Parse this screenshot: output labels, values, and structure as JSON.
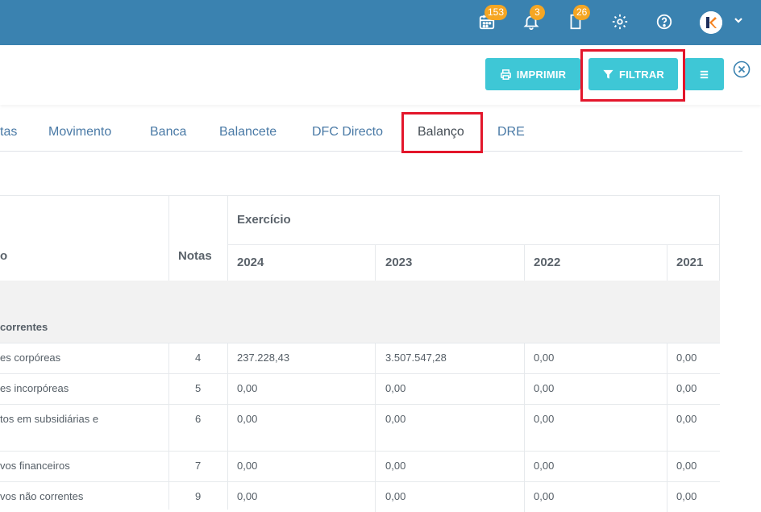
{
  "topbar": {
    "badges": {
      "calendar": "153",
      "bell": "3",
      "documents": "26"
    },
    "icons": [
      "calendar-icon",
      "bell-icon",
      "document-icon",
      "gear-icon",
      "help-icon",
      "avatar",
      "chevron-down-icon"
    ],
    "color": "#3a82b0"
  },
  "toolbar": {
    "print_label": "IMPRIMIR",
    "filter_label": "FILTRAR",
    "accent": "#3ec7d6",
    "highlight": "#e3162b"
  },
  "tabs": [
    {
      "label": "tas"
    },
    {
      "label": "Movimento"
    },
    {
      "label": "Banca"
    },
    {
      "label": "Balancete"
    },
    {
      "label": "DFC Directo"
    },
    {
      "label": "Balanço",
      "active": true
    },
    {
      "label": "DRE"
    }
  ],
  "table": {
    "col_desc": "o",
    "col_notes": "Notas",
    "group_header": "Exercício",
    "years": [
      "2024",
      "2023",
      "2022",
      "2021"
    ],
    "section": "correntes",
    "rows": [
      {
        "desc": "es corpóreas",
        "nota": "4",
        "values": [
          "237.228,43",
          "3.507.547,28",
          "0,00",
          "0,00"
        ]
      },
      {
        "desc": "es incorpóreas",
        "nota": "5",
        "values": [
          "0,00",
          "0,00",
          "0,00",
          "0,00"
        ]
      },
      {
        "desc": "tos em subsidiárias e",
        "nota": "6",
        "values": [
          "0,00",
          "0,00",
          "0,00",
          "0,00"
        ]
      },
      {
        "desc": "vos financeiros",
        "nota": "7",
        "values": [
          "0,00",
          "0,00",
          "0,00",
          "0,00"
        ]
      },
      {
        "desc": "vos não correntes",
        "nota": "9",
        "values": [
          "0,00",
          "0,00",
          "0,00",
          "0,00"
        ]
      }
    ]
  }
}
